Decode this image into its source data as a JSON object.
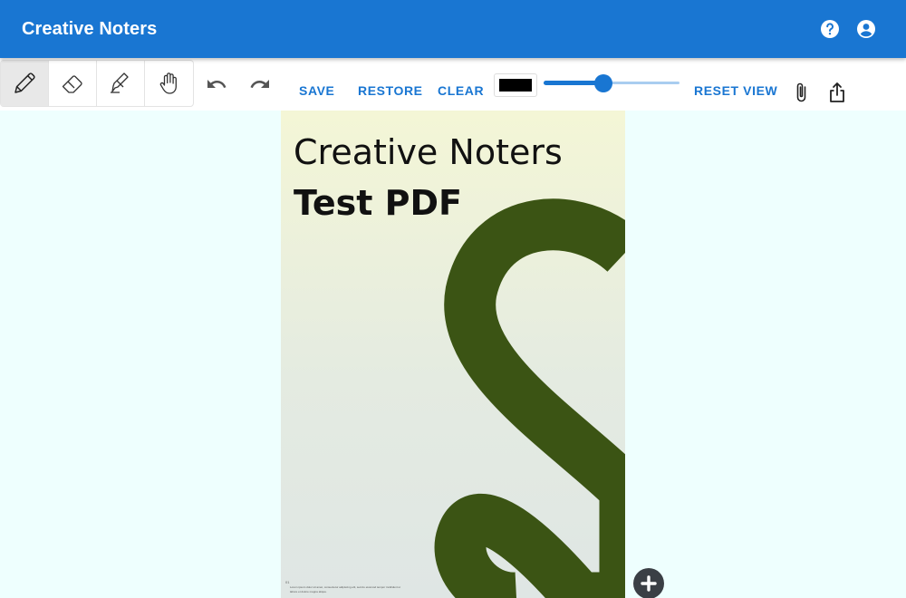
{
  "app": {
    "title": "Creative Noters"
  },
  "appbar": {
    "help_icon": "help-circle-icon",
    "account_icon": "account-circle-icon"
  },
  "toolbar": {
    "tools": [
      {
        "name": "pencil",
        "icon": "pencil-icon",
        "selected": true
      },
      {
        "name": "eraser",
        "icon": "eraser-icon",
        "selected": false
      },
      {
        "name": "highlighter",
        "icon": "highlighter-icon",
        "selected": false
      },
      {
        "name": "pan",
        "icon": "hand-icon",
        "selected": false
      }
    ],
    "undo_icon": "undo-icon",
    "redo_icon": "redo-icon",
    "save_label": "SAVE",
    "restore_label": "RESTORE",
    "clear_label": "CLEAR",
    "stroke_color": "#000000",
    "stroke_size_fraction": 0.44,
    "reset_view_label": "RESET VIEW",
    "attach_icon": "paperclip-icon",
    "share_icon": "share-icon"
  },
  "document": {
    "title": "Creative Noters",
    "subtitle": "Test PDF",
    "page_number": "01",
    "footer_text": "Lorem ipsum dolor sit amet, consectetur adipiscing elit, sed do eiusmod tempor incididunt ut labore et dolore magna aliqua."
  },
  "add_page_icon": "plus-circle-icon",
  "colors": {
    "appbar": "#1976d2",
    "accent": "#1976d2",
    "canvas_background": "#eefffe",
    "artwork": "#3b5414"
  }
}
